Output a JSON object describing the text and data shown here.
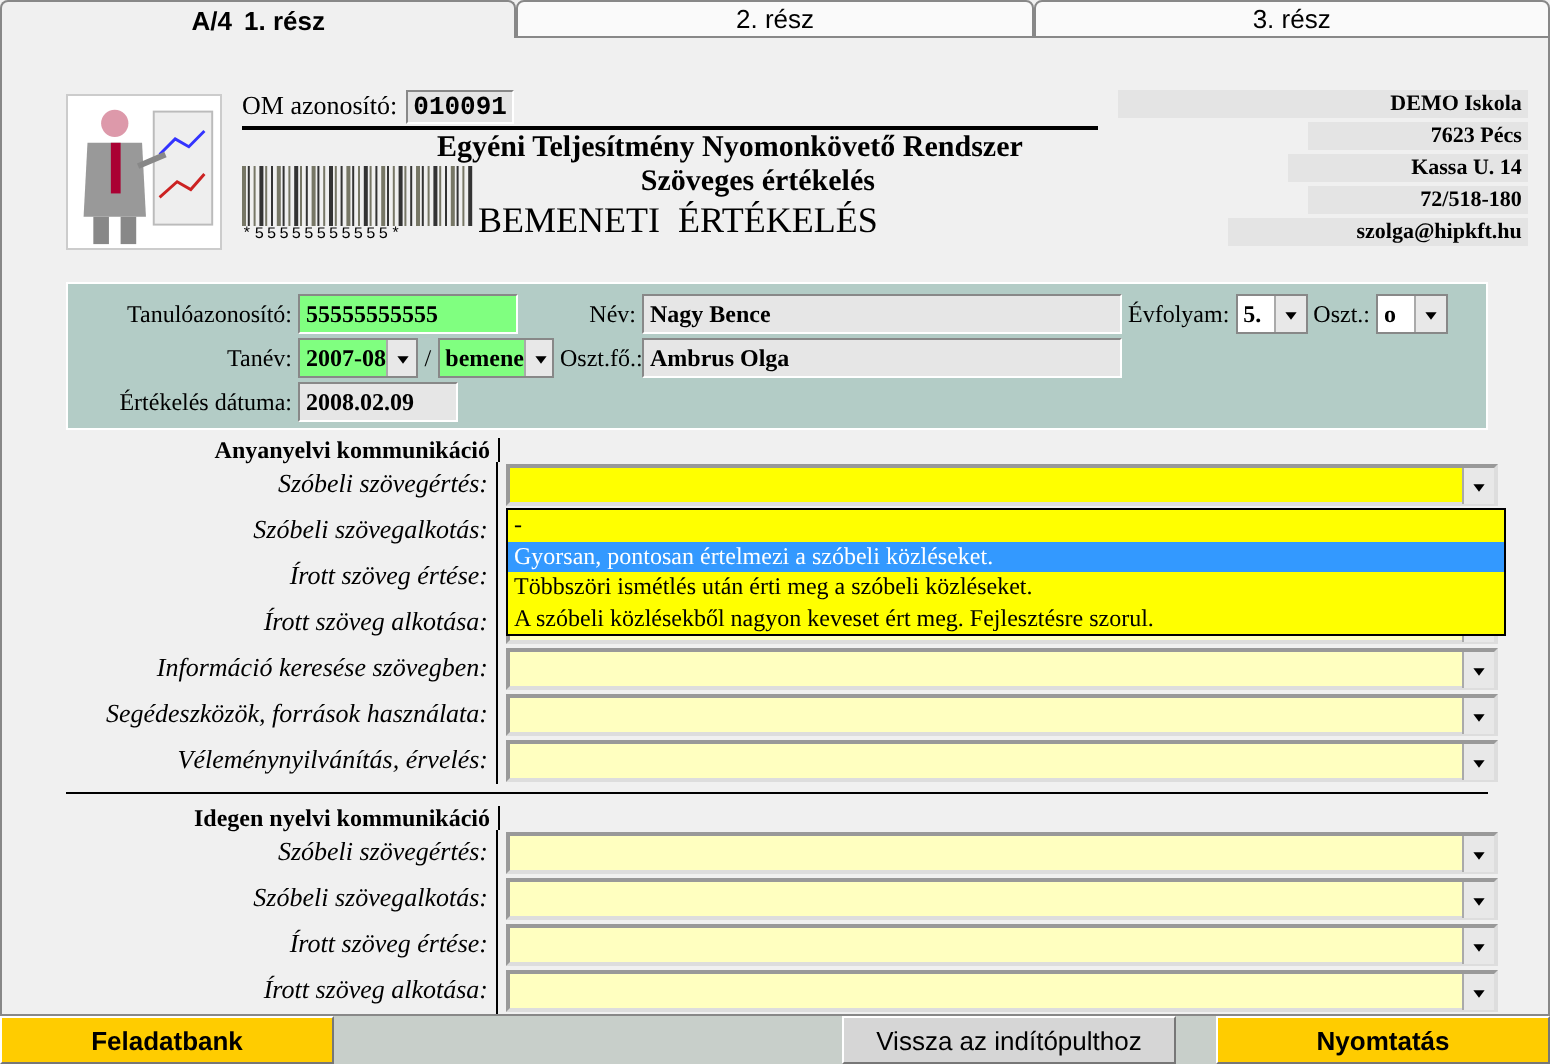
{
  "tabs": [
    {
      "prefix": "A/4",
      "label": "1. rész",
      "selected": true
    },
    {
      "label": "2. rész",
      "selected": false
    },
    {
      "label": "3. rész",
      "selected": false
    }
  ],
  "header": {
    "om_label": "OM azonosító:",
    "om_value": "010091",
    "title": "Egyéni Teljesítmény Nyomonkövető Rendszer",
    "subtitle": "Szöveges értékelés",
    "barcode_text": "*55555555555*",
    "heading": "BEMENETI  ÉRTÉKELÉS",
    "school": [
      "DEMO Iskola",
      "7623 Pécs",
      "Kassa U. 14",
      "72/518-180",
      "szolga@hipkft.hu"
    ]
  },
  "student": {
    "id_label": "Tanulóazonosító:",
    "id_value": "55555555555",
    "year_label": "Tanév:",
    "year_value": "2007-08",
    "separator": "/",
    "phase_value": "bemene",
    "date_label": "Értékelés dátuma:",
    "date_value": "2008.02.09",
    "name_label": "Név:",
    "name_value": "Nagy Bence",
    "teacher_label": "Oszt.fő.:",
    "teacher_value": "Ambrus Olga",
    "grade_label": "Évfolyam:",
    "grade_value": "5.",
    "class_label": "Oszt.:",
    "class_value": "o"
  },
  "sections": [
    {
      "title": "Anyanyelvi kommunikáció",
      "rows": [
        {
          "label": "Szóbeli szövegértés:",
          "expanded": true,
          "options": [
            {
              "text": "-",
              "selected": false
            },
            {
              "text": "Gyorsan, pontosan értelmezi a szóbeli közléseket.",
              "selected": true
            },
            {
              "text": "Többszöri ismétlés után érti meg a szóbeli közléseket.",
              "selected": false
            },
            {
              "text": "A szóbeli közlésekből nagyon keveset ért meg. Fejlesztésre szorul.",
              "selected": false
            }
          ]
        },
        {
          "label": "Szóbeli szövegalkotás:"
        },
        {
          "label": "Írott szöveg értése:"
        },
        {
          "label": "Írott szöveg alkotása:"
        },
        {
          "label": "Információ keresése szövegben:"
        },
        {
          "label": "Segédeszközök, források használata:"
        },
        {
          "label": "Véleménynyilvánítás, érvelés:"
        }
      ]
    },
    {
      "title": "Idegen nyelvi kommunikáció",
      "rows": [
        {
          "label": "Szóbeli szövegértés:"
        },
        {
          "label": "Szóbeli szövegalkotás:"
        },
        {
          "label": "Írott szöveg értése:"
        },
        {
          "label": "Írott szöveg alkotása:"
        }
      ]
    }
  ],
  "buttons": [
    {
      "label": "Feladatbank",
      "kind": "primary"
    },
    {
      "label": "Vissza az indítópulthoz",
      "kind": "secondary"
    },
    {
      "label": "Nyomtatás",
      "kind": "primary"
    }
  ]
}
